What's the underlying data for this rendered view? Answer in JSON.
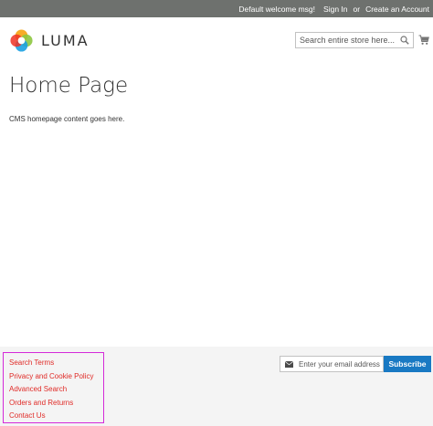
{
  "topbar": {
    "welcome": "Default welcome msg!",
    "sign_in": "Sign In",
    "or": "or",
    "create_account": "Create an Account"
  },
  "header": {
    "logo_text": "LUMA",
    "search_placeholder": "Search entire store here...",
    "search_value": ""
  },
  "main": {
    "page_title": "Home Page",
    "cms_content": "CMS homepage content goes here."
  },
  "footer": {
    "links": [
      "Search Terms",
      "Privacy and Cookie Policy",
      "Advanced Search",
      "Orders and Returns",
      "Contact Us"
    ],
    "newsletter_placeholder": "Enter your email address",
    "newsletter_value": "",
    "subscribe_label": "Subscribe"
  },
  "colors": {
    "topbar_bg": "#6e716e",
    "link_red": "#e02b27",
    "subscribe_blue": "#1979c3",
    "footer_bg": "#f4f4f4",
    "highlight_border": "#d42ad9"
  },
  "icons": {
    "logo": "luma-logo-icon",
    "search": "search-icon",
    "cart": "cart-icon",
    "mail": "mail-icon"
  }
}
